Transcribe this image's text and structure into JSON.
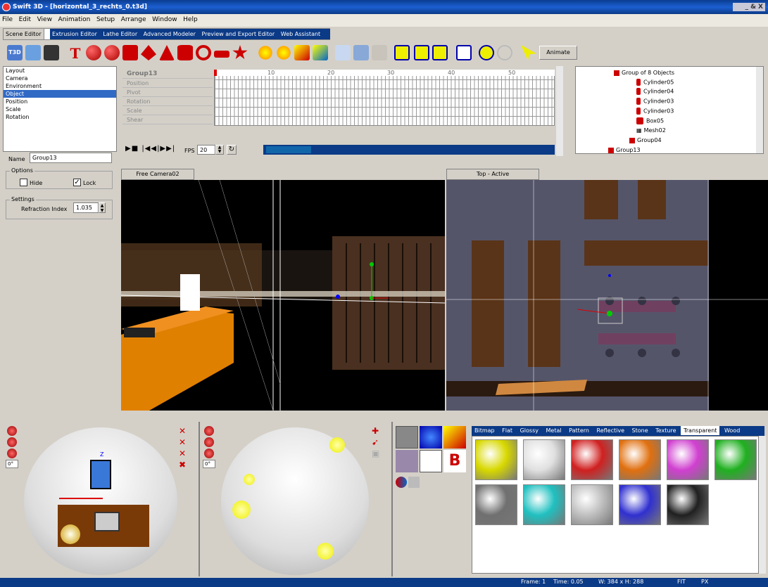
{
  "window": {
    "title": "Swift 3D - [horizontal_3_rechts_0.t3d]",
    "controls": "_ & X"
  },
  "menu": [
    "File",
    "Edit",
    "View",
    "Animation",
    "Setup",
    "Arrange",
    "Window",
    "Help"
  ],
  "editor_tabs": {
    "active": "Scene Editor",
    "others": [
      "Extrusion Editor",
      "Lathe Editor",
      "Advanced Modeler",
      "Preview and Export Editor",
      "Web Assistant"
    ]
  },
  "toolbar": {
    "animate_label": "Animate"
  },
  "props": {
    "items": [
      "Layout",
      "Camera",
      "Environment",
      "Object",
      "Position",
      "Scale",
      "Rotation"
    ],
    "selected_index": 3,
    "name_label": "Name",
    "name_value": "Group13",
    "options_label": "Options",
    "hide_label": "Hide",
    "lock_label": "Lock",
    "hide_checked": false,
    "lock_checked": true,
    "settings_label": "Settings",
    "refraction_label": "Refraction Index",
    "refraction_value": "1.035"
  },
  "timeline": {
    "object": "Group13",
    "tracks": [
      "Position",
      "Pivot",
      "Rotation",
      "Scale",
      "Shear"
    ],
    "ruler": [
      "10",
      "20",
      "30",
      "40",
      "50"
    ],
    "fps_label": "FPS",
    "fps_value": "20"
  },
  "tree": {
    "group_label": "Group of 8 Objects",
    "children": [
      "Cylinder05",
      "Cylinder04",
      "Cylinder03",
      "Cylinder03",
      "Box05",
      "Mesh02",
      "Group04"
    ],
    "sibling": "Group13"
  },
  "viewports": {
    "left": "Free Camera02",
    "right": "Top - Active"
  },
  "trackballs": {
    "rotation_a": "0°",
    "rotation_b": "0°",
    "axis_label": "Z"
  },
  "materials": {
    "tabs": [
      "Bitmap",
      "Flat",
      "Glossy",
      "Metal",
      "Pattern",
      "Reflective",
      "Stone",
      "Texture",
      "Transparent",
      "Wood"
    ],
    "active_tab": "Transparent",
    "swatch_colors": [
      "#d8d800",
      "#e0e0e0",
      "#d02020",
      "#e07010",
      "#d040d0",
      "#20b020",
      "#707070",
      "#20c0c0",
      "#c0c0c0",
      "#3030d0",
      "#202020"
    ]
  },
  "status": {
    "frame": "Frame: 1",
    "time": "Time: 0.05",
    "size": "W: 384 x H: 288",
    "fit": "FIT",
    "px": "PX"
  }
}
